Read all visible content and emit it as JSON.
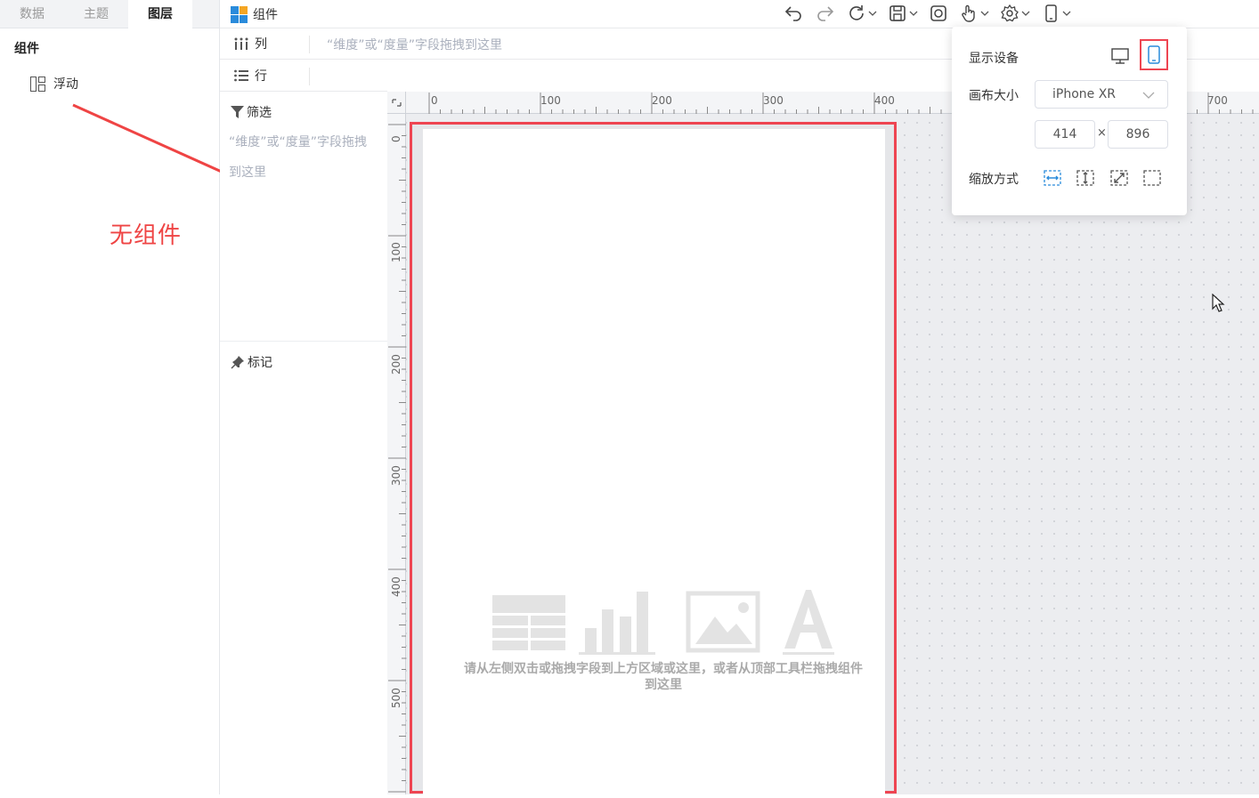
{
  "left_tabs": [
    "数据",
    "主题",
    "图层"
  ],
  "active_tab": "图层",
  "layers": {
    "title": "组件",
    "item_label": "浮动"
  },
  "annotation": {
    "text": "无组件",
    "color": "#ef4444"
  },
  "topbar": {
    "component_label": "组件"
  },
  "shelves": {
    "columns_label": "列",
    "columns_hint": "“维度”或“度量”字段拖拽到这里",
    "rows_label": "行",
    "filter_label": "筛选",
    "filter_hint": "“维度”或“度量”字段拖拽到这里",
    "mark_label": "标记"
  },
  "ruler": {
    "h_labels": [
      "0",
      "100",
      "200",
      "300",
      "400",
      "700"
    ],
    "v_labels": [
      "0",
      "100",
      "200",
      "300",
      "400",
      "500"
    ]
  },
  "canvas": {
    "empty_text": "请从左侧双击或拖拽字段到上方区域或这里，或者从顶部工具栏拖拽组件到这里",
    "frame_color": "#ee4552"
  },
  "device_popup": {
    "display_device_label": "显示设备",
    "canvas_size_label": "画布大小",
    "device_name": "iPhone XR",
    "width": "414",
    "times": "×",
    "height": "896",
    "scale_label": "缩放方式",
    "selected_device": "mobile-icon",
    "accent": "#2a8bdb"
  }
}
